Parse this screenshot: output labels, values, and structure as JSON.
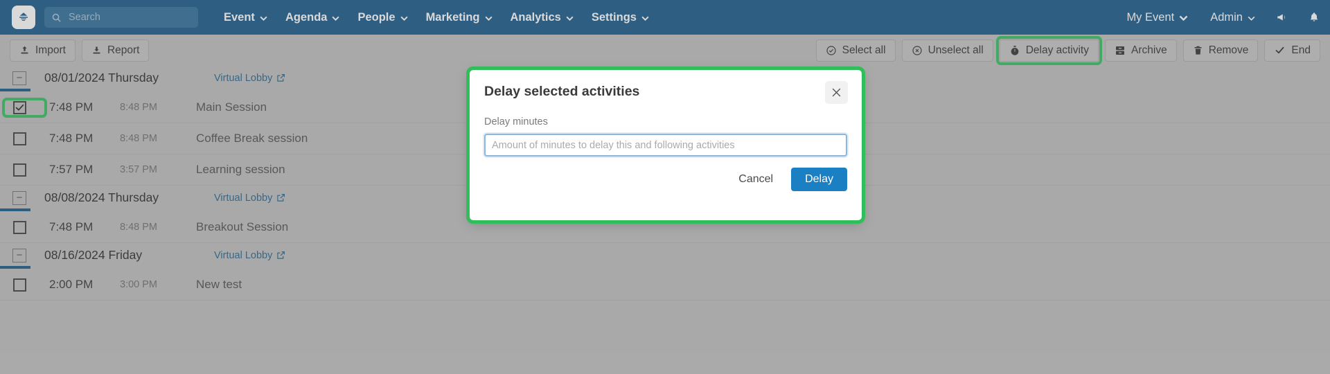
{
  "navbar": {
    "logo_icon": "event-logo-icon",
    "search": {
      "placeholder": "Search",
      "value": "",
      "icon": "search-icon"
    },
    "menu": [
      {
        "label": "Event",
        "icon": "chevron-down-icon"
      },
      {
        "label": "Agenda",
        "icon": "chevron-down-icon"
      },
      {
        "label": "People",
        "icon": "chevron-down-icon"
      },
      {
        "label": "Marketing",
        "icon": "chevron-down-icon"
      },
      {
        "label": "Analytics",
        "icon": "chevron-down-icon"
      },
      {
        "label": "Settings",
        "icon": "chevron-down-icon"
      }
    ],
    "right": [
      {
        "label": "My Event",
        "icon": "chevron-down-icon"
      },
      {
        "label": "Admin",
        "icon": "chevron-down-icon"
      }
    ],
    "announcement_icon": "megaphone-icon",
    "notification_icon": "bell-icon"
  },
  "toolbar": {
    "left": [
      {
        "label": "Import",
        "icon": "upload-icon"
      },
      {
        "label": "Report",
        "icon": "download-icon"
      }
    ],
    "right": [
      {
        "label": "Select all",
        "icon": "check-circle-icon",
        "highlighted": false
      },
      {
        "label": "Unselect all",
        "icon": "x-circle-icon",
        "highlighted": false
      },
      {
        "label": "Delay activity",
        "icon": "stopwatch-icon",
        "highlighted": true
      },
      {
        "label": "Archive",
        "icon": "archive-icon",
        "highlighted": false
      },
      {
        "label": "Remove",
        "icon": "trash-icon",
        "highlighted": false
      },
      {
        "label": "End",
        "icon": "check-icon",
        "highlighted": false
      }
    ]
  },
  "agenda": {
    "lobby_label": "Virtual Lobby",
    "groups": [
      {
        "date": "08/01/2024 Thursday",
        "activities": [
          {
            "start": "7:48 PM",
            "end": "8:48 PM",
            "title": "Main Session",
            "checked": true,
            "highlighted": true
          },
          {
            "start": "7:48 PM",
            "end": "8:48 PM",
            "title": "Coffee Break session",
            "checked": false,
            "highlighted": false
          },
          {
            "start": "7:57 PM",
            "end": "3:57 PM",
            "title": "Learning session",
            "checked": false,
            "highlighted": false
          }
        ]
      },
      {
        "date": "08/08/2024 Thursday",
        "activities": [
          {
            "start": "7:48 PM",
            "end": "8:48 PM",
            "title": "Breakout Session",
            "checked": false,
            "highlighted": false
          }
        ]
      },
      {
        "date": "08/16/2024 Friday",
        "activities": [
          {
            "start": "2:00 PM",
            "end": "3:00 PM",
            "title": "New test",
            "checked": false,
            "highlighted": false
          }
        ]
      }
    ]
  },
  "modal": {
    "title": "Delay selected activities",
    "close_icon": "close-icon",
    "field_label": "Delay minutes",
    "input_placeholder": "Amount of minutes to delay this and following activities",
    "input_value": "",
    "cancel_label": "Cancel",
    "confirm_label": "Delay"
  },
  "colors": {
    "navbar_blue": "#125688",
    "highlight_green": "#2fbe5a",
    "primary_blue": "#1b7fc4",
    "link_blue": "#21618c",
    "page_gray": "#bdbdbd"
  }
}
